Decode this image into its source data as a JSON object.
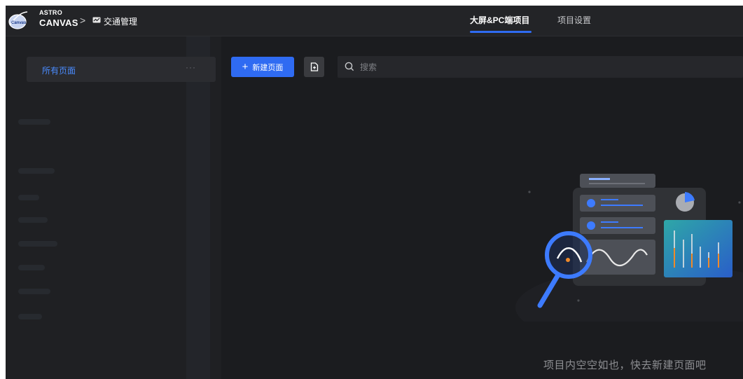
{
  "brand": {
    "line1": "ASTRO",
    "line2": "CANVAS",
    "logo_text": "Canvas"
  },
  "breadcrumb": {
    "separator": ">",
    "current": "交通管理"
  },
  "tabs": [
    {
      "label": "大屏&PC端项目",
      "active": true
    },
    {
      "label": "项目设置",
      "active": false
    }
  ],
  "sidebar": {
    "items": [
      {
        "label": "所有页面",
        "more": "···"
      }
    ]
  },
  "toolbar": {
    "new_label": "新建页面",
    "new_icon": "plus-icon",
    "import_icon": "import-file-icon"
  },
  "search": {
    "placeholder": "搜索"
  },
  "empty_state": {
    "message": "项目内空空如也，快去新建页面吧"
  },
  "colors": {
    "accent": "#2f6bf2",
    "background": "#1b1c1f",
    "topbar": "#232427"
  }
}
